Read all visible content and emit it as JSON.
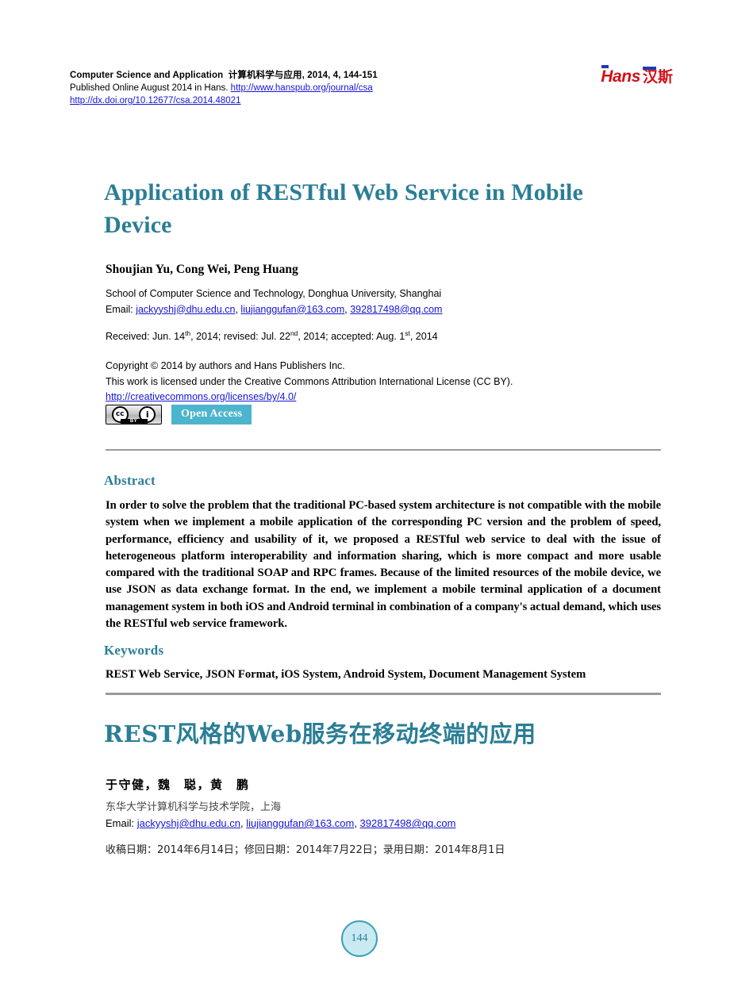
{
  "masthead": {
    "journal_en": "Computer Science and Application",
    "journal_cn": "计算机科学与应用",
    "volume_info": ", 2014, 4, 144-151",
    "published_prefix": "Published Online August 2014 in Hans. ",
    "journal_url": "http://www.hanspub.org/journal/csa",
    "doi_url": "http://dx.doi.org/10.12677/csa.2014.48021"
  },
  "logo": {
    "name_en": "Hans",
    "name_cn": "汉斯",
    "red": "#d3101a",
    "blue": "#1d3bb0"
  },
  "title": {
    "en": "Application of RESTful Web Service in Mobile Device",
    "cn": "REST风格的Web服务在移动终端的应用",
    "color": "#2a7e96"
  },
  "authors": {
    "en": "Shoujian Yu, Cong Wei, Peng Huang",
    "cn": "于守健，魏　聪，黄　鹏"
  },
  "affiliation": {
    "en": "School of Computer Science and Technology, Donghua University, Shanghai",
    "cn": "东华大学计算机科学与技术学院，上海",
    "email_label": "Email: ",
    "emails": [
      "jackyyshj@dhu.edu.cn",
      "liujianggufan@163.com",
      "392817498@qq.com"
    ]
  },
  "dates": {
    "en_prefix": "Received: Jun. 14",
    "en_sup1": "th",
    "en_mid1": ", 2014; revised: Jul. 22",
    "en_sup2": "nd",
    "en_mid2": ", 2014; accepted: Aug. 1",
    "en_sup3": "st",
    "en_suffix": ", 2014",
    "cn": "收稿日期：2014年6月14日；修回日期：2014年7月22日；录用日期：2014年8月1日"
  },
  "copyright": {
    "line1": "Copyright © 2014 by authors and Hans Publishers Inc.",
    "line2": "This work is licensed under the Creative Commons Attribution International License (CC BY).",
    "license_url": "http://creativecommons.org/licenses/by/4.0/"
  },
  "badges": {
    "cc_mark": "cc",
    "cc_by_mark": "BY",
    "cc_info": "i",
    "open_access": "Open Access",
    "open_access_bg": "#4cb5cd"
  },
  "sections": {
    "abstract_heading": "Abstract",
    "abstract_text": "In order to solve the problem that the traditional PC-based system architecture is not compatible with the mobile system when we implement a mobile application of the corresponding PC version and the problem of speed, performance, efficiency and usability of it, we proposed a RESTful web service to deal with the issue of heterogeneous platform interoperability and information sharing, which is more compact and more usable compared with the traditional SOAP and RPC frames. Because of the limited resources of the mobile device, we use JSON as data exchange format. In the end, we implement a mobile terminal application of a document management system in both iOS and Android terminal in combination of a company's actual demand, which uses the RESTful web service framework.",
    "keywords_heading": "Keywords",
    "keywords_text": "REST Web Service, JSON Format, iOS System, Android System, Document Management System"
  },
  "footer": {
    "page_number": "144"
  }
}
